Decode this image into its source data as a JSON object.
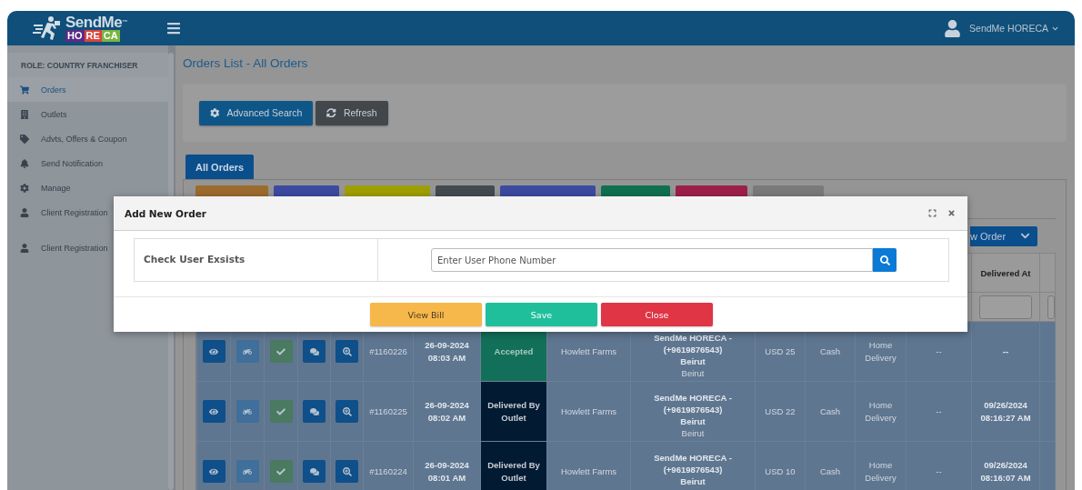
{
  "header": {
    "logo": {
      "word": "SendMe",
      "mark": "™",
      "tiles": [
        {
          "text": "HO",
          "color": "#5b2a86"
        },
        {
          "text": "RE",
          "color": "#d9453d"
        },
        {
          "text": "CA",
          "color": "#7cb342"
        }
      ]
    },
    "user": "SendMe HORECA"
  },
  "sidebar": {
    "role": "ROLE: COUNTRY FRANCHISER",
    "items": [
      {
        "label": "Orders",
        "selected": true
      },
      {
        "label": "Outlets",
        "selected": false
      },
      {
        "label": "Advts, Offers & Coupon",
        "selected": false
      },
      {
        "label": "Send Notification",
        "selected": false
      },
      {
        "label": "Manage",
        "selected": false
      },
      {
        "label": "Client Registration",
        "selected": false
      }
    ],
    "footer_items": [
      {
        "label": "Client Registration",
        "selected": false
      }
    ]
  },
  "page": {
    "title": "Orders List - All Orders",
    "actions": [
      {
        "label": "Advanced Search",
        "kind": "primary"
      },
      {
        "label": "Refresh",
        "kind": "dark"
      }
    ],
    "tabs": [
      {
        "label": "All Orders",
        "selected": true
      }
    ],
    "filter_chips": [
      {
        "color": "#9c6b2e"
      },
      {
        "color": "#3c4aa0"
      },
      {
        "color": "#9f9e00"
      },
      {
        "color": "#434a50"
      },
      {
        "color": "#3c4aa0"
      },
      {
        "color": "#0f7050"
      },
      {
        "color": "#9c1f4a"
      },
      {
        "color": "#7a7a7a"
      }
    ],
    "new_order_button": "w Order",
    "table": {
      "header": "Delivered At",
      "rows": [
        {
          "id": "#1160226",
          "date": "26-09-2024",
          "time": "08:03 AM",
          "status": {
            "text": "Accepted",
            "kind": "accepted"
          },
          "outlet": "Howlett Farms",
          "customer": [
            "SendMe HORECA -",
            "(+9619876543)",
            "Beirut",
            "Beirut"
          ],
          "amount": "USD 25",
          "payment": "Cash",
          "delivery": "Home Delivery",
          "column_10": "--",
          "delivered_at": [
            "--"
          ]
        },
        {
          "id": "#1160225",
          "date": "26-09-2024",
          "time": "08:02 AM",
          "status": {
            "text": "Delivered By Outlet",
            "kind": "delivered"
          },
          "outlet": "Howlett Farms",
          "customer": [
            "SendMe HORECA -",
            "(+9619876543)",
            "Beirut",
            "Beirut"
          ],
          "amount": "USD 22",
          "payment": "Cash",
          "delivery": "Home Delivery",
          "column_10": "--",
          "delivered_at": [
            "09/26/2024",
            "08:16:27 AM"
          ]
        },
        {
          "id": "#1160224",
          "date": "26-09-2024",
          "time": "08:01 AM",
          "status": {
            "text": "Delivered By Outlet",
            "kind": "delivered"
          },
          "outlet": "Howlett Farms",
          "customer": [
            "SendMe HORECA -",
            "(+9619876543)",
            "Beirut"
          ],
          "amount": "USD 10",
          "payment": "Cash",
          "delivery": "Home Delivery",
          "column_10": "--",
          "delivered_at": [
            "09/26/2024",
            "08:16:07 AM"
          ]
        }
      ]
    }
  },
  "modal": {
    "title": "Add New Order",
    "label": "Check User Exsists",
    "placeholder": "Enter User Phone Number",
    "buttons": [
      {
        "label": "View Bill",
        "kind": "warning"
      },
      {
        "label": "Save",
        "kind": "success"
      },
      {
        "label": "Close",
        "kind": "danger"
      }
    ]
  }
}
